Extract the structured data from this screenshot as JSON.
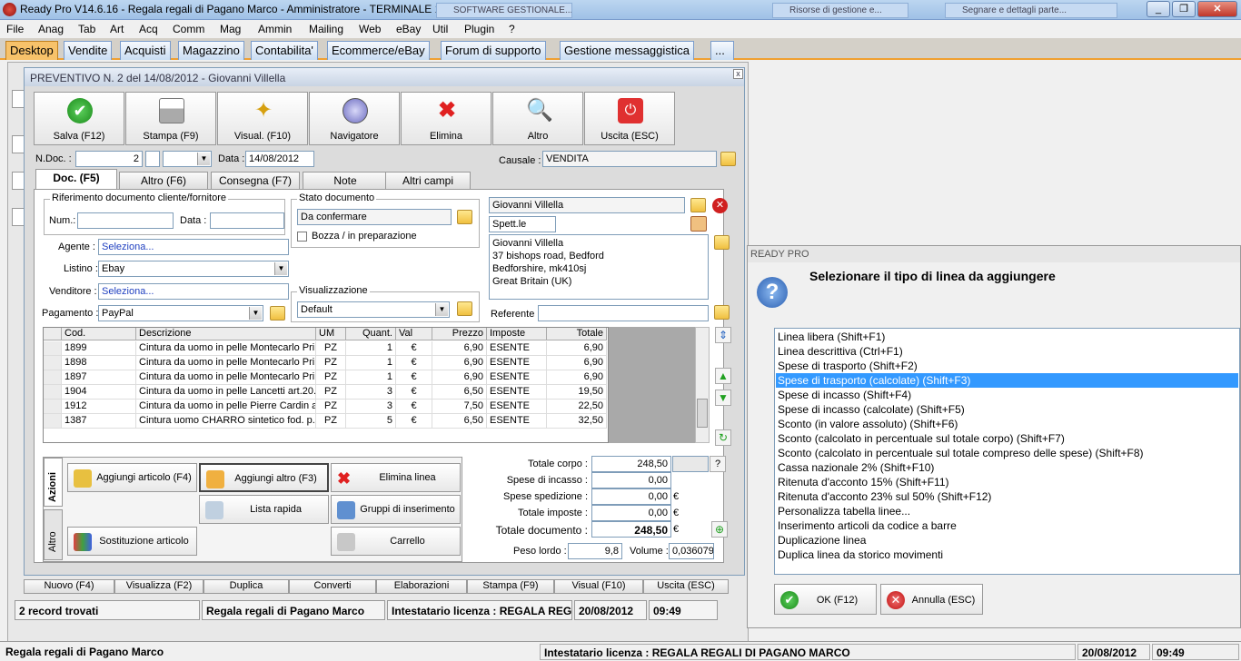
{
  "window": {
    "title": "Ready Pro V14.6.16 - Regala regali di Pagano Marco - Amministratore - TERMINALE 1",
    "minimize": "_",
    "maximize": "❐",
    "close": "✕"
  },
  "background_tasks": [
    "SOFTWARE GESTIONALE...",
    "Risorse di gestione e...",
    "Segnare e dettagli parte..."
  ],
  "menu": [
    "File",
    "Anag",
    "Tab",
    "Art",
    "Acq",
    "Comm",
    "Mag",
    "Ammin",
    "Mailing",
    "Web",
    "eBay",
    "Util",
    "Plugin",
    "?"
  ],
  "tabs": [
    "Desktop",
    "Vendite",
    "Acquisti",
    "Magazzino",
    "Contabilita'",
    "Ecommerce/eBay",
    "Forum di supporto",
    "Gestione messaggistica",
    "..."
  ],
  "dialog": {
    "title": "PREVENTIVO N. 2  del 14/08/2012 - Giovanni Villella",
    "close": "x",
    "toolbar": [
      "Salva (F12)",
      "Stampa (F9)",
      "Visual. (F10)",
      "Navigatore",
      "Elimina",
      "Altro",
      "Uscita (ESC)"
    ],
    "ndoc_label": "N.Doc. :",
    "ndoc_value": "2",
    "data_label": "Data :",
    "data_value": "14/08/2012",
    "causale_label": "Causale :",
    "causale_value": "VENDITA",
    "subtabs": [
      "Doc. (F5)",
      "Altro (F6)",
      "Consegna (F7)",
      "Note",
      "Altri campi"
    ],
    "rif_group": "Riferimento documento cliente/fornitore",
    "num_label": "Num.:",
    "data2_label": "Data :",
    "stato_group": "Stato documento",
    "stato_value": "Da confermare",
    "bozza_label": "Bozza / in preparazione",
    "agente_label": "Agente :",
    "agente_value": "Seleziona...",
    "listino_label": "Listino :",
    "listino_value": "Ebay",
    "venditore_label": "Venditore :",
    "venditore_value": "Seleziona...",
    "pagamento_label": "Pagamento :",
    "pagamento_value": "PayPal",
    "visual_group": "Visualizzazione",
    "visual_value": "Default",
    "cliente_name": "Giovanni Villella",
    "cliente_title": "Spett.le",
    "address": [
      "Giovanni Villella",
      "37 bishops road, Bedford",
      "Bedforshire, mk410sj",
      "Great Britain (UK)"
    ],
    "referente_label": "Referente :",
    "grid_headers": [
      "Cod.",
      "Descrizione",
      "UM",
      "Quant.",
      "Val",
      "Prezzo",
      "Imposte",
      "Totale"
    ],
    "rows": [
      [
        "1899",
        "Cintura da uomo in pelle Montecarlo Pri...",
        "PZ",
        "1",
        "€",
        "6,90",
        "ESENTE",
        "6,90"
      ],
      [
        "1898",
        "Cintura da uomo in pelle Montecarlo Pri...",
        "PZ",
        "1",
        "€",
        "6,90",
        "ESENTE",
        "6,90"
      ],
      [
        "1897",
        "Cintura da uomo in pelle Montecarlo Pri...",
        "PZ",
        "1",
        "€",
        "6,90",
        "ESENTE",
        "6,90"
      ],
      [
        "1904",
        "Cintura da uomo in pelle Lancetti art.20...",
        "PZ",
        "3",
        "€",
        "6,50",
        "ESENTE",
        "19,50"
      ],
      [
        "1912",
        "Cintura da uomo in pelle Pierre Cardin a...",
        "PZ",
        "3",
        "€",
        "7,50",
        "ESENTE",
        "22,50"
      ],
      [
        "1387",
        "Cintura uomo CHARRO sintetico fod. p...",
        "PZ",
        "5",
        "€",
        "6,50",
        "ESENTE",
        "32,50"
      ]
    ],
    "vtab_azioni": "Azioni",
    "vtab_altro": "Altro",
    "actions": [
      "Aggiungi articolo (F4)",
      "Aggiungi altro (F3)",
      "Elimina linea",
      "Lista rapida",
      "Gruppi di inserimento",
      "Sostituzione articolo",
      "Carrello"
    ],
    "totals": {
      "corpo_label": "Totale corpo :",
      "corpo": "248,50",
      "corpo_q": "?",
      "incasso_label": "Spese di incasso :",
      "incasso": "0,00",
      "spedizione_label": "Spese spedizione :",
      "spedizione": "0,00",
      "spedizione_cur": "€",
      "imposte_label": "Totale imposte :",
      "imposte": "0,00",
      "imposte_cur": "€",
      "documento_label": "Totale documento :",
      "documento": "248,50",
      "documento_cur": "€",
      "peso_label": "Peso lordo :",
      "peso": "9,8",
      "volume_label": "Volume :",
      "volume": "0,036079"
    }
  },
  "bottom_buttons": [
    "Nuovo (F4)",
    "Visualizza (F2)",
    "Duplica",
    "Converti",
    "Elaborazioni",
    "Stampa (F9)",
    "Visual (F10)",
    "Uscita (ESC)"
  ],
  "status": {
    "records": "2 record trovati",
    "company": "Regala regali di Pagano Marco",
    "license": "Intestatario licenza : REGALA REG",
    "date": "20/08/2012",
    "time": "09:49"
  },
  "right_dialog": {
    "title": "READY PRO",
    "question": "Selezionare il tipo di linea da aggiungere",
    "items": [
      "Linea libera (Shift+F1)",
      "Linea descrittiva (Ctrl+F1)",
      "Spese di trasporto (Shift+F2)",
      "Spese di trasporto (calcolate) (Shift+F3)",
      "Spese di incasso (Shift+F4)",
      "Spese di incasso (calcolate) (Shift+F5)",
      "Sconto (in valore assoluto) (Shift+F6)",
      "Sconto (calcolato in percentuale sul totale corpo) (Shift+F7)",
      "Sconto (calcolato in percentuale sul totale compreso delle spese) (Shift+F8)",
      "Cassa nazionale 2% (Shift+F10)",
      "Ritenuta d'acconto 15% (Shift+F11)",
      "Ritenuta d'acconto 23% sul 50% (Shift+F12)",
      "Personalizza tabella linee...",
      "Inserimento articoli da codice a barre",
      "Duplicazione linea",
      "Duplica linea da storico movimenti"
    ],
    "selected_index": 3,
    "ok": "OK (F12)",
    "cancel": "Annulla (ESC)"
  },
  "bottom_status": {
    "company": "Regala regali di Pagano Marco",
    "license": "Intestatario licenza : REGALA REGALI DI PAGANO MARCO",
    "date": "20/08/2012",
    "time": "09:49"
  }
}
